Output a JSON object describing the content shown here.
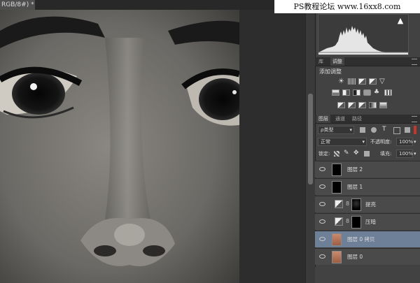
{
  "document_tab": {
    "title": "RGB/8#) *",
    "close_glyph": "×"
  },
  "watermark": "PS教程论坛 www.16xx8.com",
  "histogram": {
    "warning_glyph": "▲"
  },
  "adjust_panel": {
    "tabs": [
      "库",
      "调整"
    ],
    "active_tab": "调整",
    "title": "添加调整",
    "icons": [
      "brightness-icon",
      "levels-icon",
      "curves-icon",
      "exposure-icon",
      "vibrance-icon",
      "hue-saturation-icon",
      "color-balance-icon",
      "black-white-icon",
      "photo-filter-icon",
      "channel-mixer-icon",
      "color-lookup-icon",
      "invert-icon",
      "posterize-icon",
      "threshold-icon",
      "gradient-map-icon",
      "selective-color-icon"
    ]
  },
  "layers_panel": {
    "tabs": [
      "图层",
      "通道",
      "路径"
    ],
    "active_tab": "图层",
    "filter_kind": "ρ类型",
    "blend_mode": "正常",
    "opacity_label": "不透明度:",
    "opacity_value": "100%",
    "lock_label": "锁定:",
    "fill_label": "填充:",
    "fill_value": "100%",
    "layers": [
      {
        "name": "图层 2",
        "thumb": "black",
        "selected": false
      },
      {
        "name": "图层 1",
        "thumb": "black",
        "selected": false
      },
      {
        "name": "提亮",
        "type": "adjustment",
        "mask": "dark",
        "selected": false
      },
      {
        "name": "压暗",
        "type": "adjustment",
        "mask": "black",
        "selected": false
      },
      {
        "name": "图层 0 拷贝",
        "thumb": "portrait",
        "selected": true
      },
      {
        "name": "图层 0",
        "thumb": "portrait",
        "selected": false
      }
    ]
  },
  "colors": {
    "selection": "#6e7f98",
    "panel": "#424242",
    "canvas_bg": "#1f1f1f"
  }
}
